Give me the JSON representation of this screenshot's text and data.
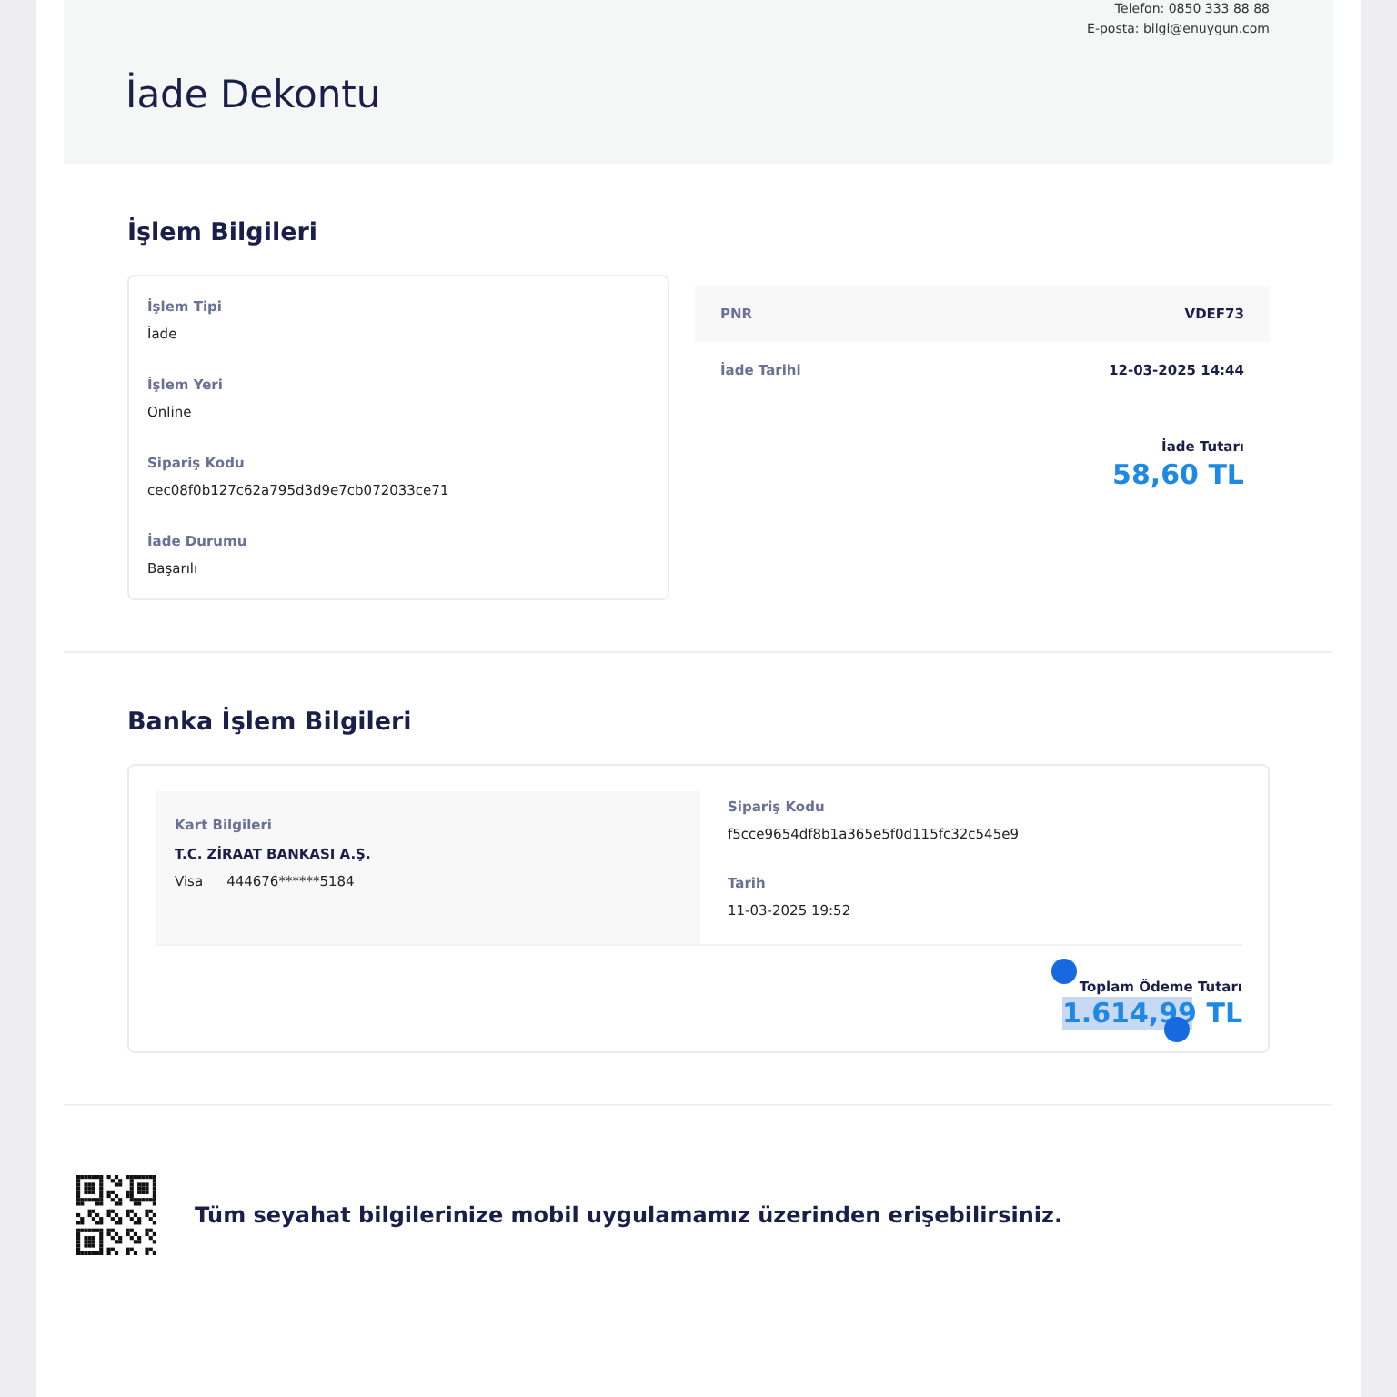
{
  "header": {
    "contact": [
      "Telefon: 0850 333 88 88",
      "E-posta: bilgi@enuygun.com"
    ],
    "title": "İade Dekontu"
  },
  "transaction": {
    "title": "İşlem Bilgileri",
    "fields": [
      {
        "label": "İşlem Tipi",
        "value": "İade"
      },
      {
        "label": "İşlem Yeri",
        "value": "Online"
      },
      {
        "label": "Sipariş Kodu",
        "value": "cec08f0b127c62a795d3d9e7cb072033ce71"
      },
      {
        "label": "İade Durumu",
        "value": "Başarılı"
      }
    ],
    "summary": [
      {
        "label": "PNR",
        "value": "VDEF73"
      },
      {
        "label": "İade Tarihi",
        "value": "12-03-2025 14:44"
      }
    ],
    "total_label": "İade Tutarı",
    "total": "58,60 TL"
  },
  "bank": {
    "title": "Banka İşlem Bilgileri",
    "card_label": "Kart Bilgileri",
    "bank_name": "T.C. ZİRAAT BANKASI A.Ş.",
    "card_type": "Visa",
    "card_number": "444676******5184",
    "fields": [
      {
        "label": "Sipariş Kodu",
        "value": "f5cce9654df8b1a365e5f0d115fc32c545e9"
      },
      {
        "label": "Tarih",
        "value": "11-03-2025 19:52"
      }
    ],
    "total_label": "Toplam Ödeme Tutarı",
    "total": "1.614,99 TL",
    "total_selected": true
  },
  "footer": {
    "message": "Tüm seyahat bilgilerinize mobil uygulamamız üzerinden erişebilirsiniz."
  }
}
